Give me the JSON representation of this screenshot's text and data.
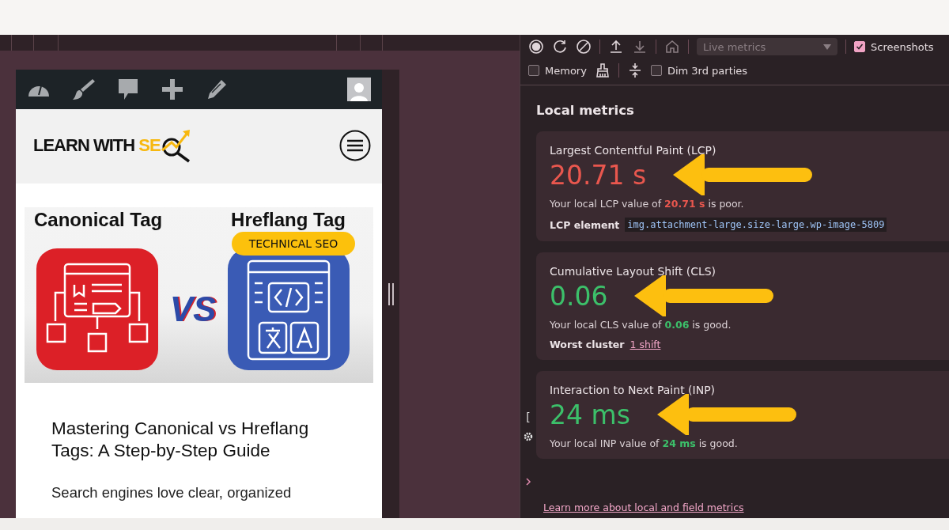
{
  "device_page": {
    "logo": {
      "text": "LEARN WITH",
      "accent": "SE"
    },
    "post": {
      "image": {
        "left_title": "Canonical Tag",
        "right_title": "Hreflang Tag",
        "vs": "VS"
      },
      "category": "TECHNICAL SEO",
      "title": "Mastering Canonical vs Hreflang Tags: A Step-by-Step Guide",
      "excerpt": "Search engines love clear, organized"
    }
  },
  "toolbar": {
    "preset": {
      "value": "Live metrics",
      "disabled": true
    },
    "options": [
      {
        "label": "Screenshots",
        "checked": true
      },
      {
        "label": "Memory",
        "checked": false
      },
      {
        "label": "Dim 3rd parties",
        "checked": false
      }
    ]
  },
  "side_strip": {
    "text": "["
  },
  "local_metrics": {
    "heading": "Local metrics",
    "metrics": [
      {
        "title": "Largest Contentful Paint (LCP)",
        "value": "20.71 s",
        "color": "#e9574e",
        "sentence": "Your local LCP value of **20.71 s** is poor.",
        "detail": {
          "kind": "code",
          "label": "LCP element",
          "value": "img.attachment-large.size-large.wp-image-5809"
        }
      },
      {
        "title": "Cumulative Layout Shift (CLS)",
        "value": "0.06",
        "color": "#3cc06a",
        "sentence": "Your local CLS value of **0.06** is good.",
        "detail": {
          "kind": "link",
          "label": "Worst cluster",
          "value": "1 shift"
        }
      },
      {
        "title": "Interaction to Next Paint (INP)",
        "value": "24 ms",
        "color": "#3cc06a",
        "sentence": "Your local INP value of **24 ms** is good."
      }
    ],
    "link": "Learn more about local and field metrics"
  }
}
